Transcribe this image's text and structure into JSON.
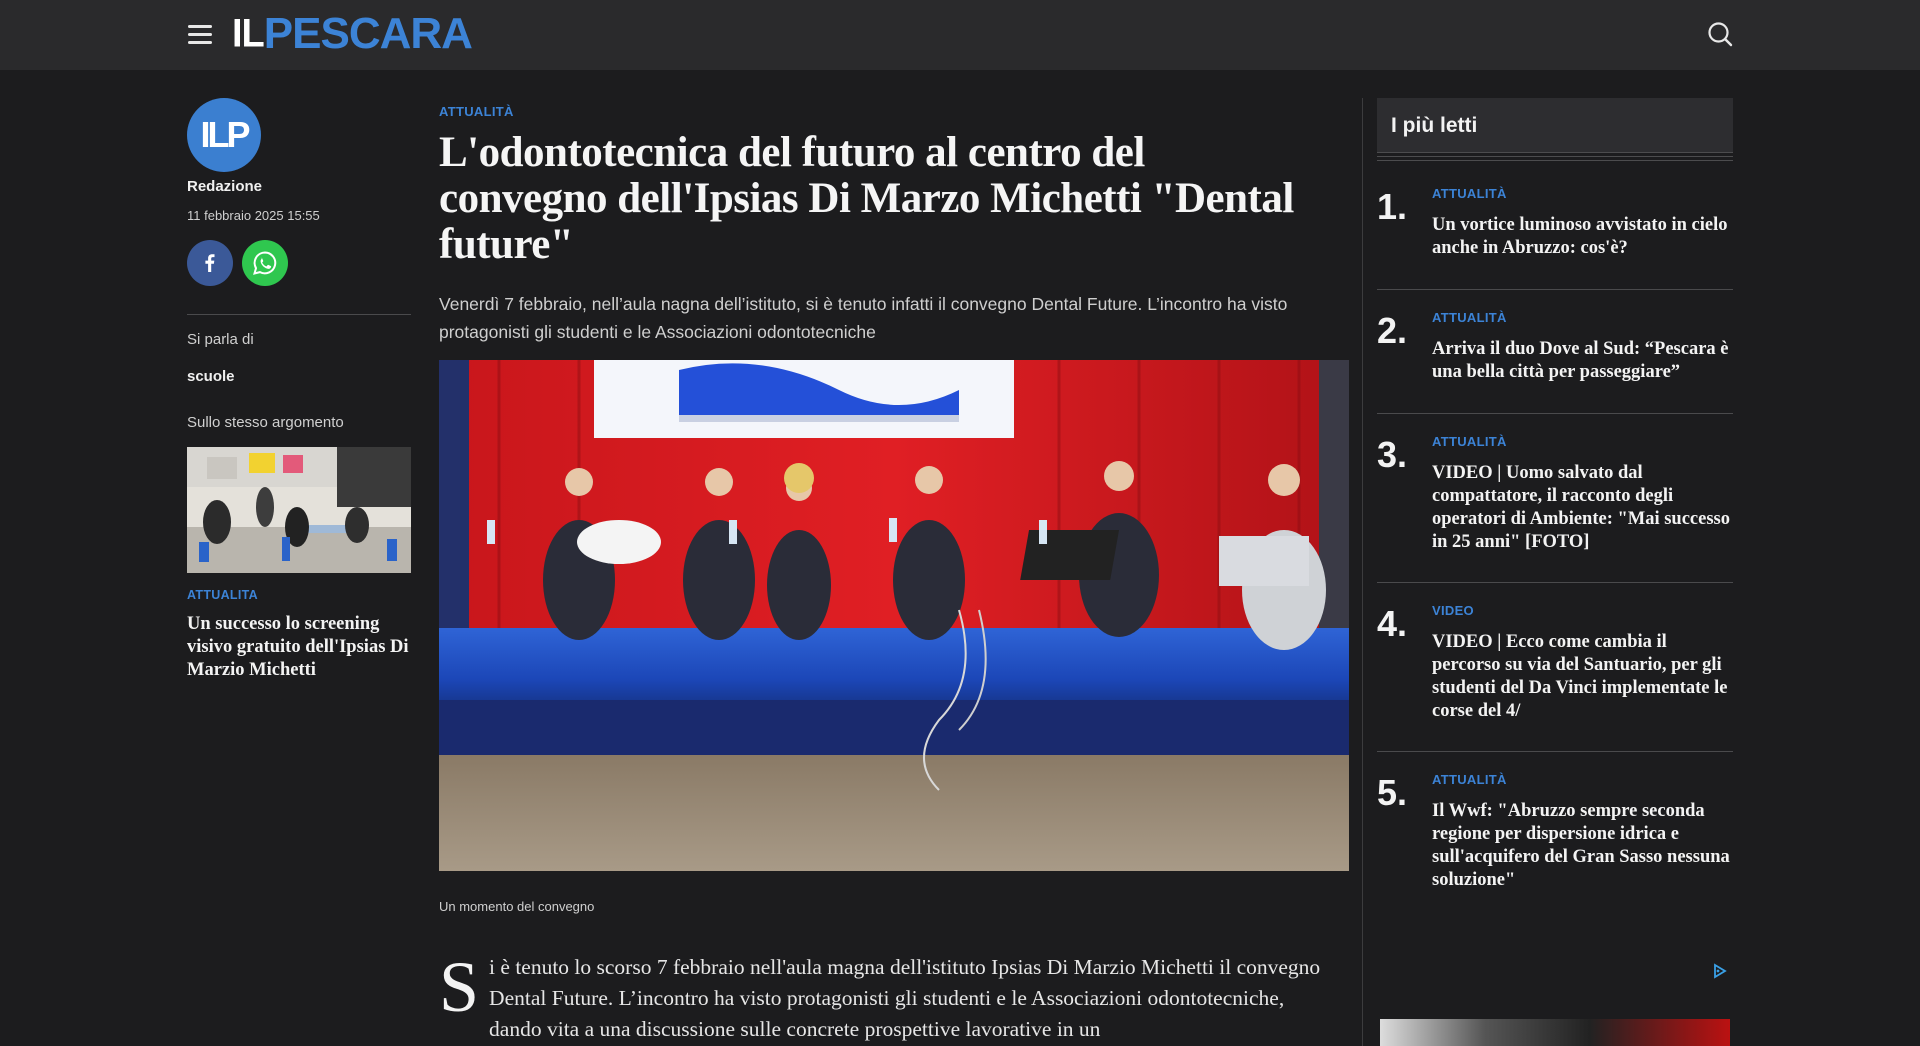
{
  "header": {
    "logo_il": "IL",
    "logo_pescara": "PESCARA"
  },
  "author": {
    "avatar_text": "ILP",
    "name": "Redazione",
    "date": "11 febbraio 2025 15:55"
  },
  "left": {
    "talk_label": "Si parla di",
    "talk_tag": "scuole",
    "same_topic_label": "Sullo stesso argomento",
    "related": {
      "category": "ATTUALITA",
      "title": "Un successo lo screening visivo gratuito dell'Ipsias Di Marzio Michetti"
    }
  },
  "article": {
    "category": "ATTUALITÀ",
    "title": "L'odontotecnica del futuro al centro del convegno dell'Ipsias Di Marzo Michetti \"Dental future\"",
    "lead": "Venerdì 7 febbraio, nell’aula nagna dell’istituto, si è tenuto infatti il convegno Dental Future. L’incontro ha visto protagonisti gli studenti e le Associazioni odontotecniche",
    "caption": "Un momento del convegno",
    "dropcap": "S",
    "body": "i è tenuto lo scorso 7 febbraio nell'aula magna dell'istituto Ipsias Di Marzio Michetti il convegno Dental Future. L’incontro ha visto protagonisti gli studenti e le Associazioni odontotecniche, dando vita a una discussione sulle concrete prospettive lavorative in un"
  },
  "most_read": {
    "heading": "I più letti",
    "items": [
      {
        "num": "1.",
        "category": "ATTUALITÀ",
        "title": "Un vortice luminoso avvistato in cielo anche in Abruzzo: cos'è?"
      },
      {
        "num": "2.",
        "category": "ATTUALITÀ",
        "title": "Arriva il duo Dove al Sud: “Pescara è una bella città per passeggiare”"
      },
      {
        "num": "3.",
        "category": "ATTUALITÀ",
        "title": "VIDEO | Uomo salvato dal compattatore, il racconto degli operatori di Ambiente: \"Mai successo in 25 anni\" [FOTO]"
      },
      {
        "num": "4.",
        "category": "VIDEO",
        "title": "VIDEO | Ecco come cambia il percorso su via del Santuario, per gli studenti del Da Vinci implementate le corse del 4/"
      },
      {
        "num": "5.",
        "category": "ATTUALITÀ",
        "title": "Il Wwf: \"Abruzzo sempre seconda regione per dispersione idrica e sull'acquifero del Gran Sasso nessuna soluzione\""
      }
    ]
  },
  "colors": {
    "accent": "#3c83d6",
    "background": "#1c1c1e",
    "topbar": "#2a2a2c",
    "facebook": "#3b5998",
    "whatsapp": "#2fc74f"
  },
  "icons": [
    "menu-icon",
    "search-icon",
    "facebook-icon",
    "whatsapp-icon",
    "adchoices-icon"
  ]
}
